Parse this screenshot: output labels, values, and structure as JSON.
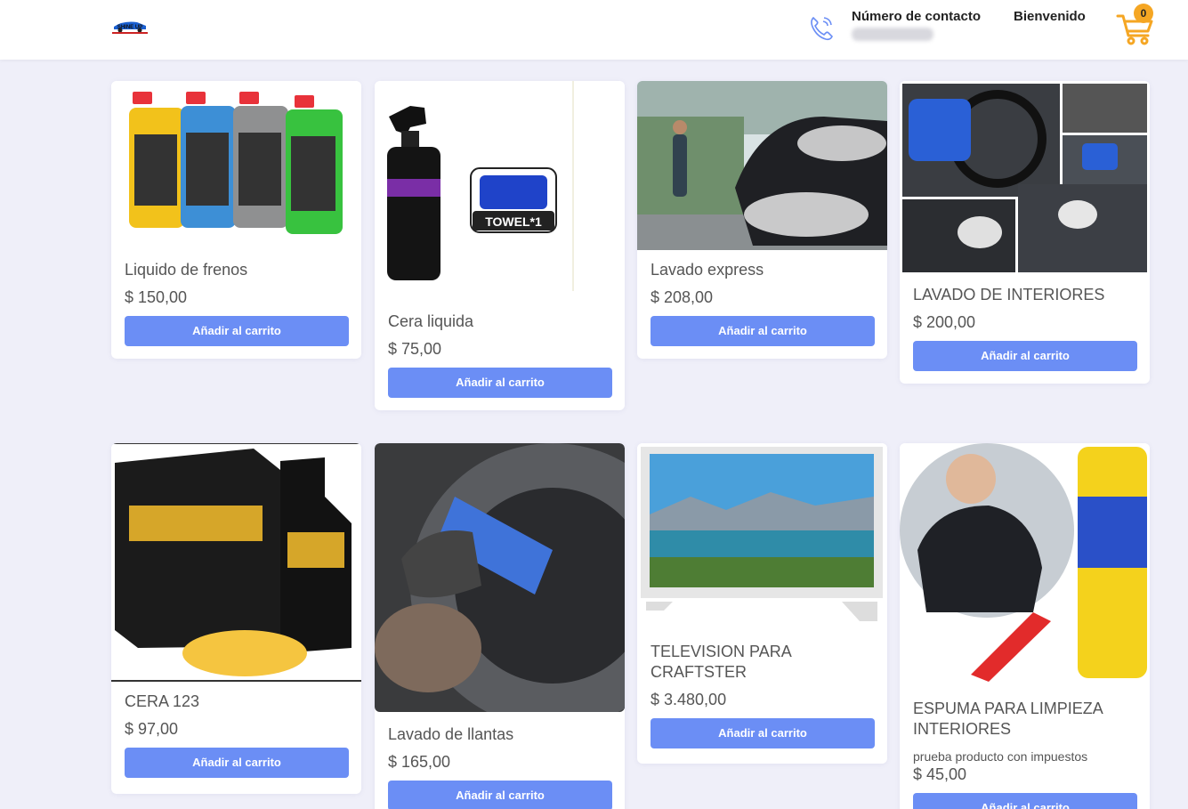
{
  "header": {
    "logo_text": "SHINE UP",
    "contact_label": "Número de contacto",
    "contact_value": "",
    "welcome": "Bienvenido",
    "cart_count": "0"
  },
  "colors": {
    "accent": "#6b8ef5",
    "badge": "#f5a623",
    "background": "#efeff9"
  },
  "products": [
    {
      "title": "Liquido de frenos",
      "price": "$ 150,00",
      "button": "Añadir al carrito"
    },
    {
      "title": "Cera liquida",
      "price": "$ 75,00",
      "button": "Añadir al carrito",
      "image_label": "TOWEL*1"
    },
    {
      "title": "Lavado express",
      "price": "$ 208,00",
      "button": "Añadir al carrito"
    },
    {
      "title": "LAVADO DE INTERIORES",
      "price": "$ 200,00",
      "button": "Añadir al carrito"
    },
    {
      "title": "CERA 123",
      "price": "$ 97,00",
      "button": "Añadir al carrito"
    },
    {
      "title": "Lavado de llantas",
      "price": "$ 165,00",
      "button": "Añadir al carrito"
    },
    {
      "title": "TELEVISION PARA CRAFTSTER",
      "price": "$ 3.480,00",
      "button": "Añadir al carrito"
    },
    {
      "title": "ESPUMA PARA LIMPIEZA INTERIORES",
      "description": "prueba producto con impuestos",
      "price": "$ 45,00",
      "button": "Añadir al carrito"
    }
  ]
}
